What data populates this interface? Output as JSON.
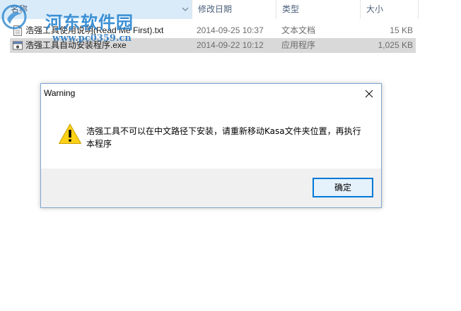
{
  "explorer": {
    "columns": {
      "name": "名称",
      "date": "修改日期",
      "type": "类型",
      "size": "大小"
    },
    "files": [
      {
        "name": "浩强工具使用说明(Read Me First).txt",
        "date": "2014-09-25 10:37",
        "type": "文本文档",
        "size": "15 KB",
        "icon": "text-file-icon"
      },
      {
        "name": "浩强工具自动安装程序.exe",
        "date": "2014-09-22 10:12",
        "type": "应用程序",
        "size": "1,025 KB",
        "icon": "application-icon",
        "selected": true
      }
    ]
  },
  "watermark": {
    "title": "河东软件园",
    "url": "www.pc0359.cn"
  },
  "dialog": {
    "title": "Warning",
    "icon": "warning-icon",
    "message": "浩强工具不可以在中文路径下安装，请重新移动Kasa文件夹位置，再执行本程序",
    "ok_label": "确定"
  },
  "colors": {
    "header_selected_bg": "#d9ebf9",
    "selected_row_bg": "#d9d9d9",
    "dialog_border": "#7fa6d1",
    "button_border": "#0078d7",
    "button_bg": "#e5f1fb",
    "watermark": "#2a86d0"
  }
}
